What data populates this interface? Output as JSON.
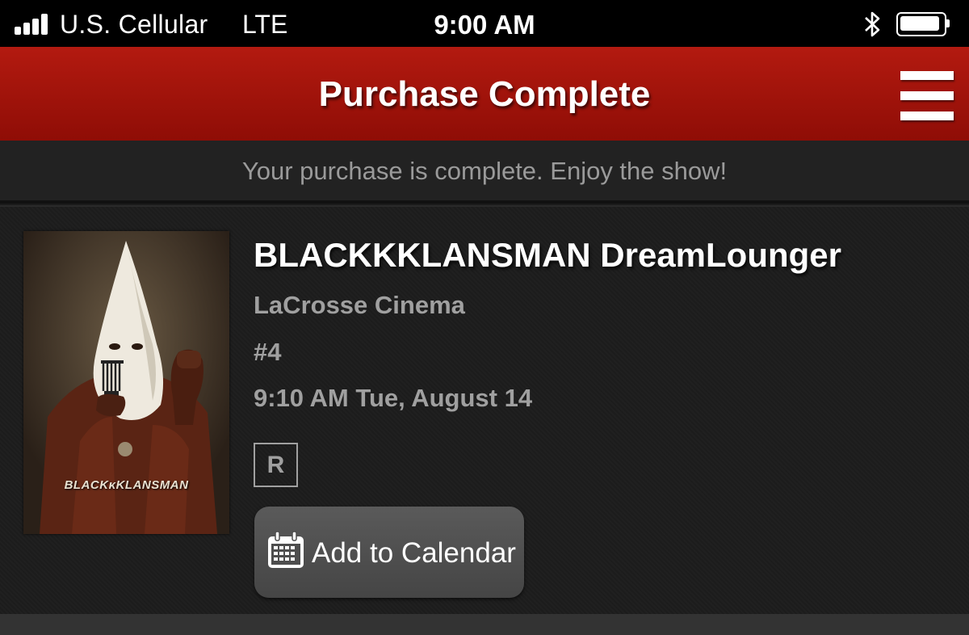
{
  "status_bar": {
    "carrier": "U.S. Cellular",
    "network": "LTE",
    "time": "9:00 AM",
    "signal_bars": 4
  },
  "header": {
    "title": "Purchase Complete"
  },
  "message": "Your purchase is complete. Enjoy the show!",
  "movie": {
    "poster_title": "BLACKᴋKLANSMAN",
    "title": "BLACKKKLANSMAN DreamLounger",
    "theater": "LaCrosse Cinema",
    "screen": "#4",
    "showtime": "9:10 AM Tue, August 14",
    "rating": "R"
  },
  "actions": {
    "add_to_calendar": "Add to Calendar"
  },
  "colors": {
    "header_red": "#a3140b",
    "background": "#1b1b1b",
    "detail_gray": "#a0a0a0"
  }
}
